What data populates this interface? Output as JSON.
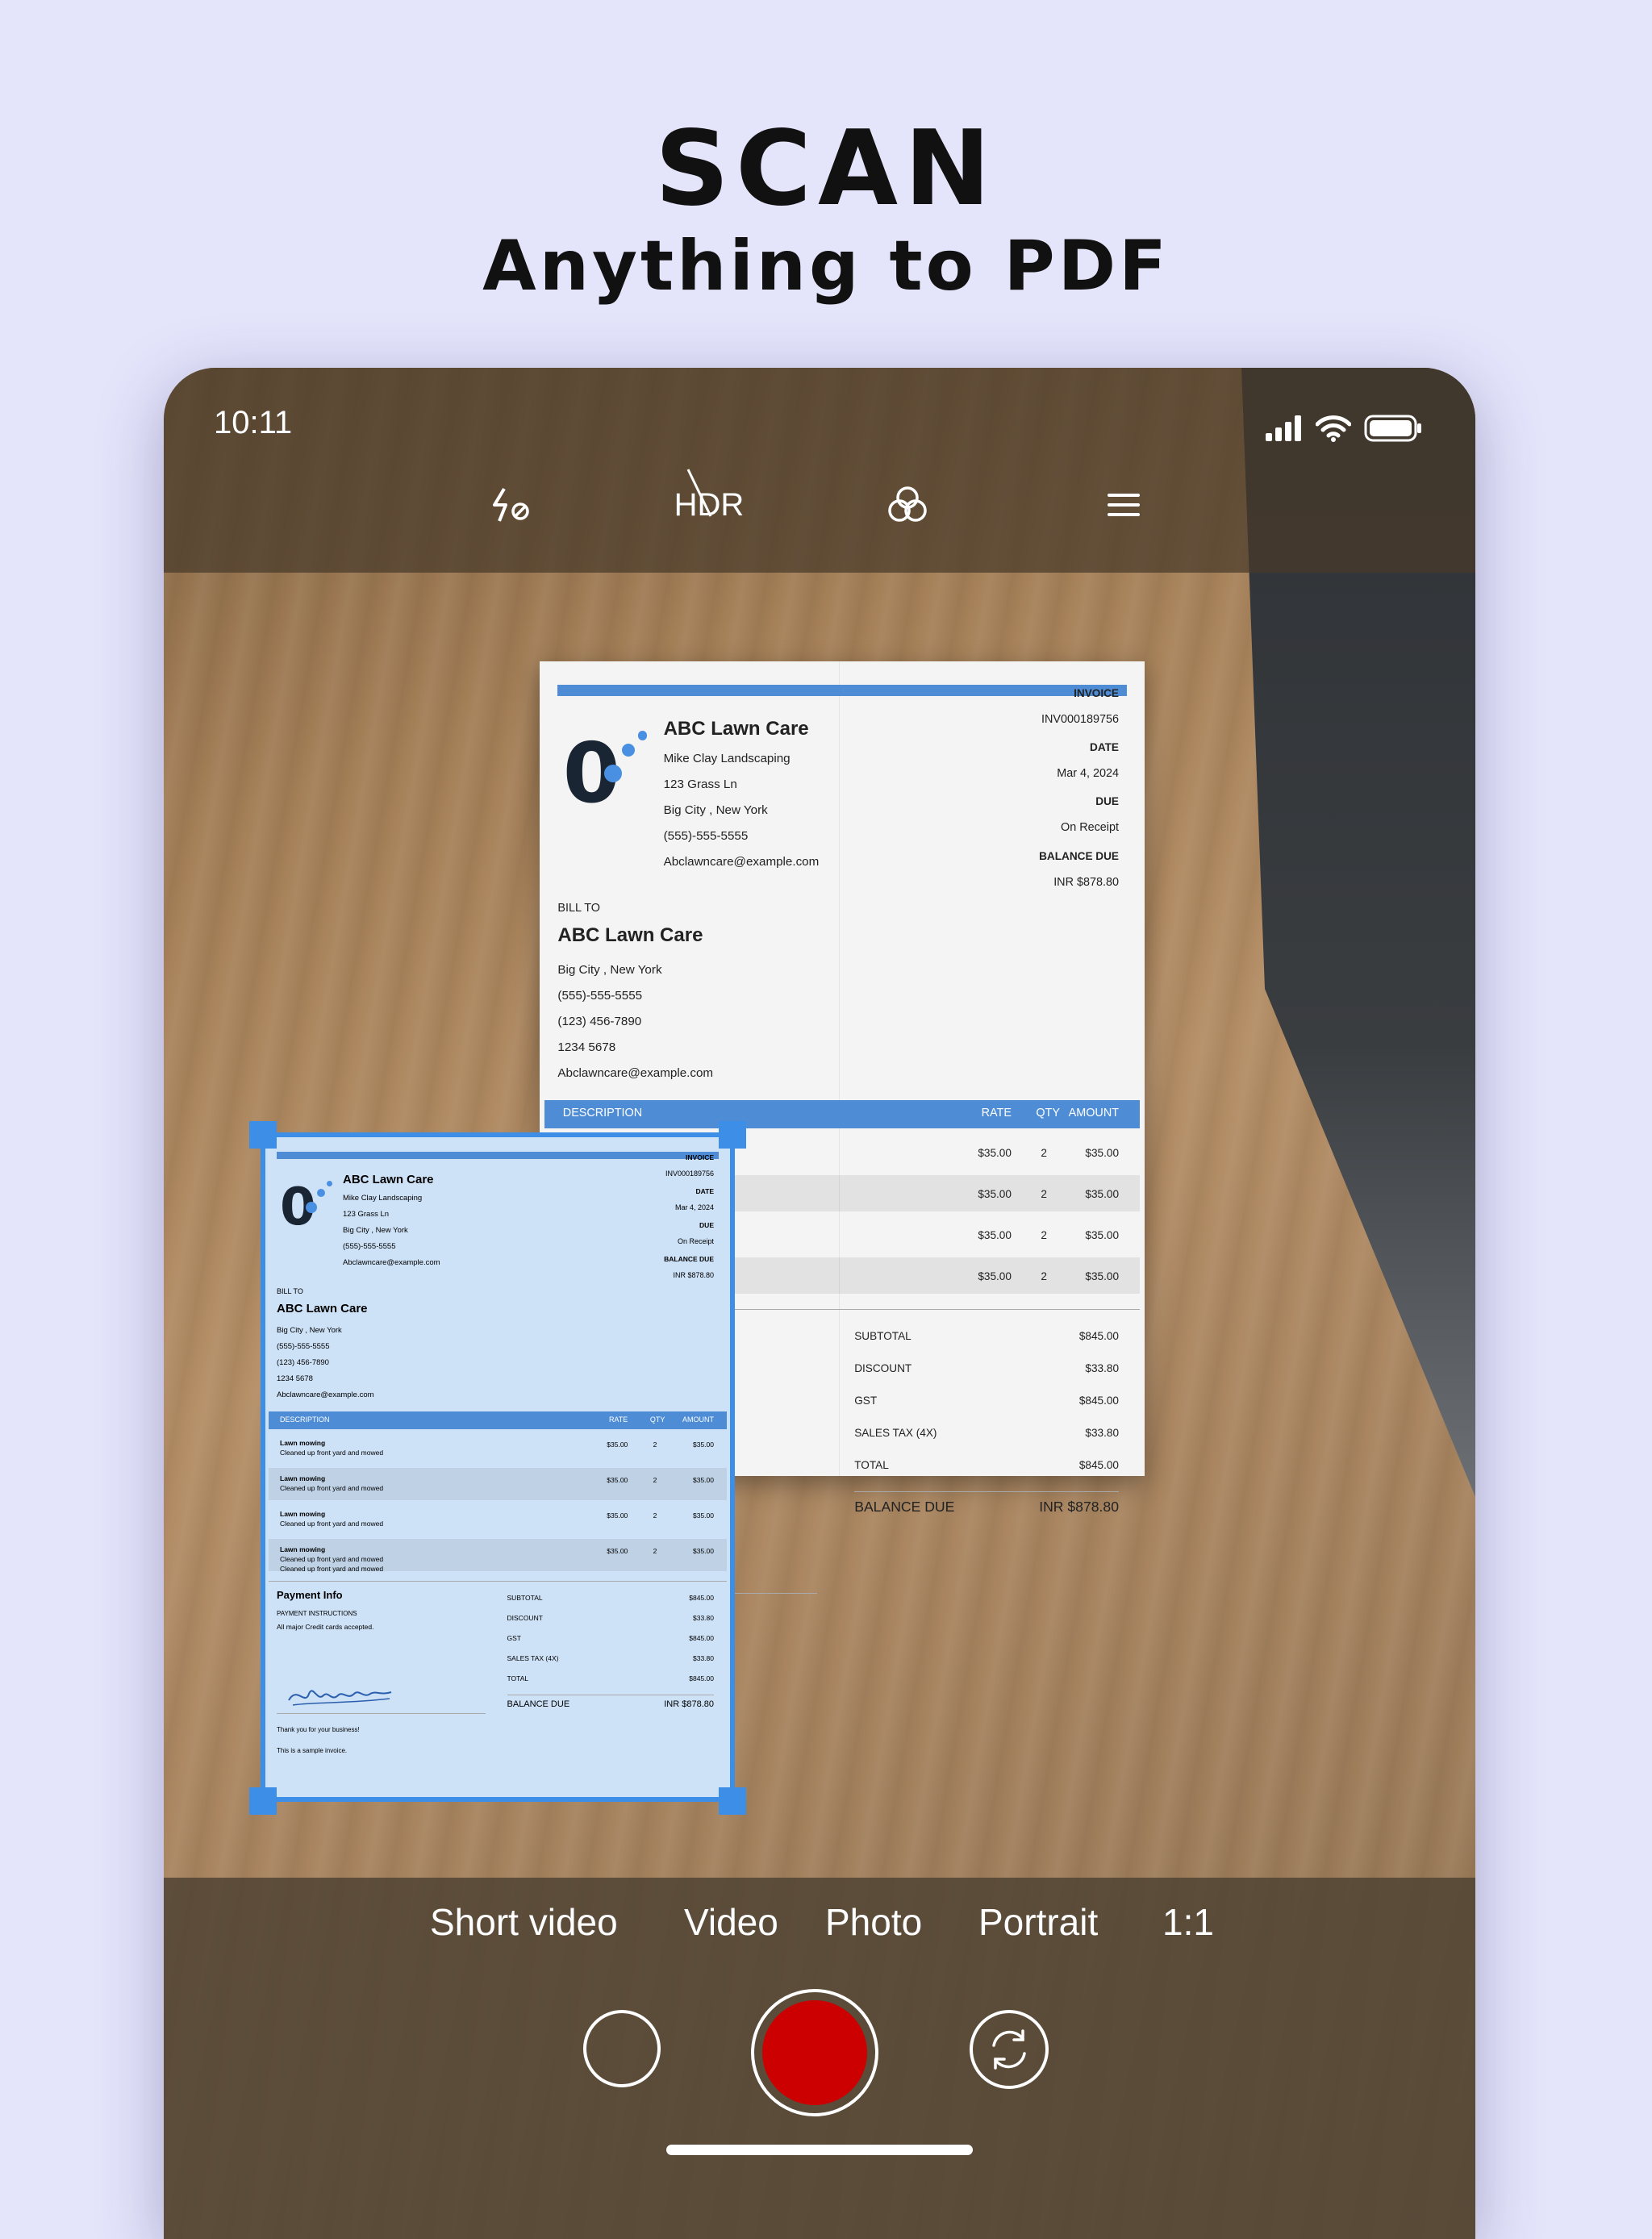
{
  "headline": {
    "title": "SCAN",
    "subtitle": "Anything to PDF"
  },
  "status_bar": {
    "time": "10:11"
  },
  "toolbar": {
    "hdr_label": "HDR"
  },
  "camera_modes": [
    "Short video",
    "Video",
    "Photo",
    "Portrait",
    "1:1"
  ],
  "icons": {
    "flash": "flash-off-icon",
    "hdr": "hdr-off-icon",
    "filters": "filters-icon",
    "menu": "menu-icon",
    "signal": "signal-icon",
    "wifi": "wifi-icon",
    "battery": "battery-icon",
    "gallery": "gallery-thumbnail-icon",
    "flip": "flip-camera-icon"
  },
  "colors": {
    "background": "#e4e4fb",
    "accent": "#3d8ee6",
    "shutter": "#cc0000",
    "invoice_blue": "#4e8dd6"
  },
  "invoice": {
    "company": "ABC Lawn Care",
    "company_lines": [
      "Mike Clay Landscaping",
      "123 Grass Ln",
      "Big City , New York",
      "(555)-555-5555",
      "Abclawncare@example.com"
    ],
    "meta": [
      {
        "label": "INVOICE",
        "value": "INV000189756"
      },
      {
        "label": "DATE",
        "value": "Mar 4, 2024"
      },
      {
        "label": "DUE",
        "value": "On Receipt"
      },
      {
        "label": "BALANCE DUE",
        "value": "INR $878.80"
      }
    ],
    "bill_to_label": "BILL TO",
    "bill_to_name": "ABC Lawn Care",
    "bill_to_lines": [
      "Big City , New York",
      "(555)-555-5555",
      "(123) 456-7890",
      "1234 5678",
      "Abclawncare@example.com"
    ],
    "columns": [
      "DESCRIPTION",
      "RATE",
      "QTY",
      "AMOUNT"
    ],
    "items": [
      {
        "name": "Lawn mowing",
        "detail": "Cleaned up front yard and mowed",
        "detail2": "",
        "rate": "$35.00",
        "qty": "2",
        "amount": "$35.00"
      },
      {
        "name": "Lawn mowing",
        "detail": "Cleaned up front yard and mowed",
        "detail2": "",
        "rate": "$35.00",
        "qty": "2",
        "amount": "$35.00"
      },
      {
        "name": "Lawn mowing",
        "detail": "Cleaned up front yard and mowed",
        "detail2": "",
        "rate": "$35.00",
        "qty": "2",
        "amount": "$35.00"
      },
      {
        "name": "Lawn mowing",
        "detail": "Cleaned up front yard and mowed",
        "detail2": "Cleaned up front yard and mowed",
        "rate": "$35.00",
        "qty": "2",
        "amount": "$35.00"
      }
    ],
    "payment_title": "Payment Info",
    "payment_instructions_label": "PAYMENT INSTRUCTIONS",
    "payment_instructions": "All major Credit cards accepted.",
    "totals": [
      {
        "label": "SUBTOTAL",
        "value": "$845.00"
      },
      {
        "label": "DISCOUNT",
        "value": "$33.80"
      },
      {
        "label": "GST",
        "value": "$845.00"
      },
      {
        "label": "SALES TAX (4X)",
        "value": "$33.80"
      },
      {
        "label": "TOTAL",
        "value": "$845.00"
      }
    ],
    "balance_due_label": "BALANCE DUE",
    "balance_due_value": "INR $878.80",
    "footer_lines": [
      "Thank you for your business!",
      "This is a sample invoice."
    ],
    "signature": "signature"
  }
}
